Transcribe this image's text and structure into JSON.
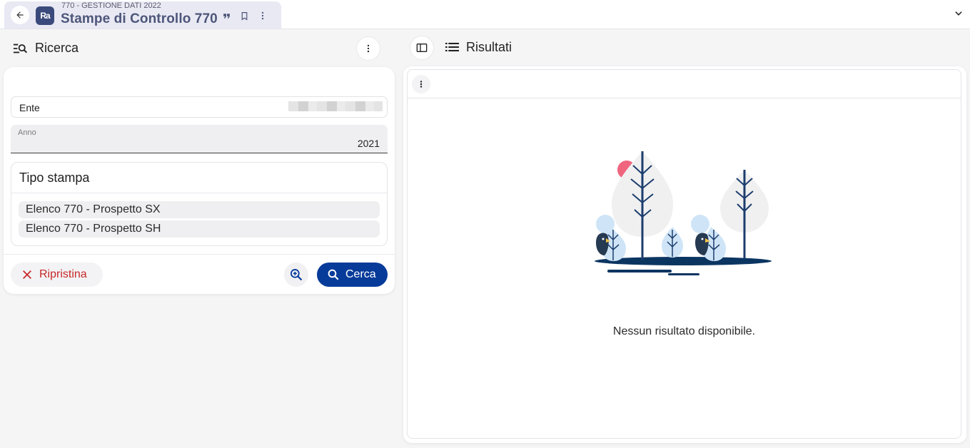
{
  "tab": {
    "subtitle": "770 - GESTIONE DATI 2022",
    "title": "Stampe di Controllo 770",
    "logo": "Ra"
  },
  "left": {
    "title": "Ricerca",
    "fields": {
      "ente_label": "Ente",
      "anno_label": "Anno",
      "anno_value": "2021"
    },
    "tipo_stampa": {
      "title": "Tipo stampa",
      "options": [
        "Elenco 770 - Prospetto SX",
        "Elenco 770 - Prospetto SH"
      ]
    },
    "buttons": {
      "reset": "Ripristina",
      "search": "Cerca"
    }
  },
  "right": {
    "title": "Risultati",
    "empty_message": "Nessun risultato disponibile."
  },
  "colors": {
    "primary": "#063b9a",
    "danger": "#c62828",
    "tab_bg": "#e9e9f4",
    "page_bg": "#f5f5f6"
  },
  "icons": {
    "back": "arrow-left-icon",
    "logo": "app-logo-icon",
    "quote": "quote-icon",
    "bookmark": "bookmark-icon",
    "more": "more-vertical-icon",
    "chevron": "chevron-down-icon",
    "search_list": "search-list-icon",
    "sidebar": "sidebar-toggle-icon",
    "list": "list-icon",
    "close": "close-icon",
    "zoom": "zoom-in-icon",
    "search": "search-icon"
  }
}
